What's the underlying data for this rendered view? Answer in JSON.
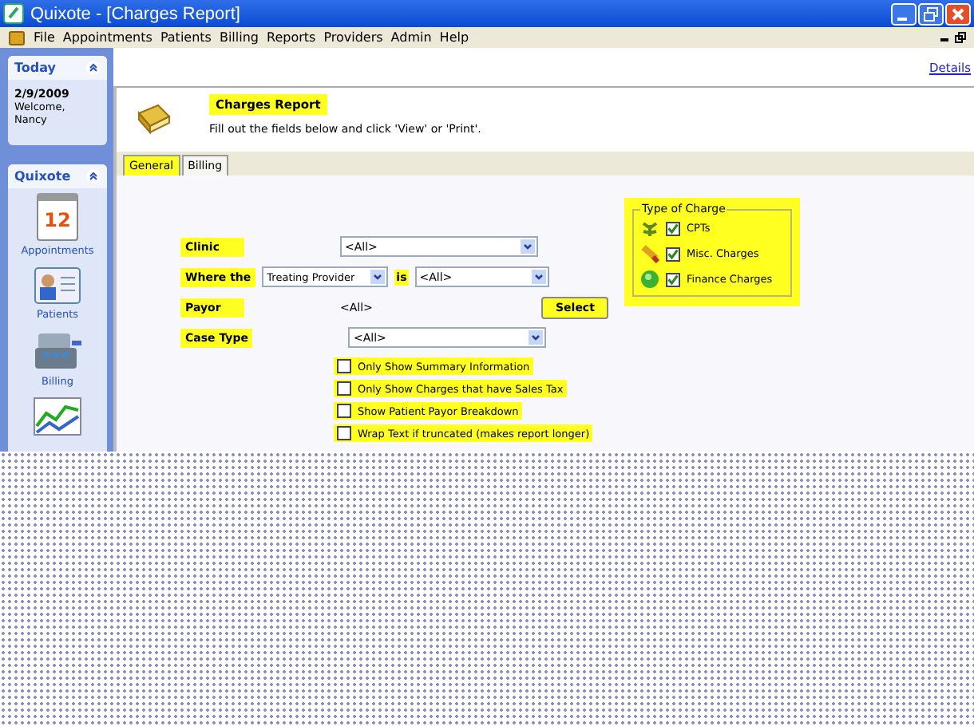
{
  "window": {
    "title": "Quixote - [Charges Report]"
  },
  "menu": [
    "File",
    "Appointments",
    "Patients",
    "Billing",
    "Reports",
    "Providers",
    "Admin",
    "Help"
  ],
  "sidebar": {
    "today": {
      "title": "Today",
      "date": "2/9/2009",
      "welcome": "Welcome,",
      "user": "Nancy"
    },
    "quixote": {
      "title": "Quixote",
      "items": [
        {
          "kind": "calendar",
          "label": "Appointments",
          "icon_text": "12"
        },
        {
          "kind": "card",
          "label": "Patients"
        },
        {
          "kind": "register",
          "label": "Billing"
        },
        {
          "kind": "chart"
        }
      ]
    }
  },
  "details_link": "Details",
  "header": {
    "title": "Charges Report",
    "subtitle": "Fill out the fields below and click 'View' or 'Print'."
  },
  "tabs": [
    {
      "label": "General",
      "selected": true
    },
    {
      "label": "Billing",
      "selected": false
    }
  ],
  "form": [
    {
      "kind": "dropdown",
      "label": "Clinic",
      "value": "<All>"
    },
    {
      "kind": "where",
      "label": "Where the",
      "field": "Treating Provider",
      "joiner": "is",
      "value": "<All>"
    },
    {
      "kind": "select",
      "label": "Payor",
      "value": "<All>",
      "button": "Select"
    },
    {
      "kind": "dropdown",
      "label": "Case Type",
      "value": "<All>"
    }
  ],
  "options": [
    {
      "label": "Only Show Summary Information",
      "checked": false
    },
    {
      "label": "Only Show Charges that have Sales Tax",
      "checked": false
    },
    {
      "label": "Show Patient Payor Breakdown",
      "checked": false
    },
    {
      "label": "Wrap Text if truncated (makes report longer)",
      "checked": false
    }
  ],
  "type_of_charge": {
    "title": "Type of Charge",
    "items": [
      {
        "kind": "cpt",
        "label": "CPTs",
        "checked": true
      },
      {
        "kind": "misc",
        "label": "Misc. Charges",
        "checked": true
      },
      {
        "kind": "finance",
        "label": "Finance Charges",
        "checked": true
      }
    ]
  }
}
